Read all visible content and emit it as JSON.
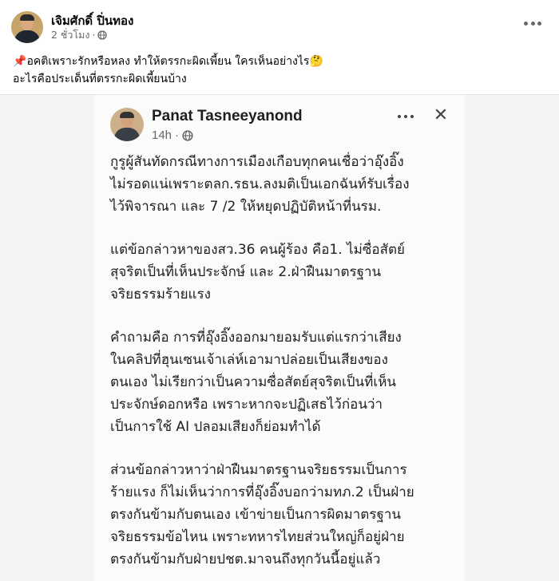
{
  "post": {
    "author": "เจิมศักดิ์ ปิ่นทอง",
    "time": "2 ชั่วโมง",
    "separator": "·",
    "privacy_icon": "globe-icon",
    "more_icon": "more-dots-icon",
    "caption_pin_icon": "📌",
    "caption_line1": "อคติเพราะรักหรือหลง ทำให้ตรรกะผิดเพี้ยน  ใครเห็นอย่างไร🤔",
    "caption_line2": "อะไรคือประเด็นที่ตรรกะผิดเพี้ยนบ้าง"
  },
  "screenshot": {
    "author": "Panat Tasneeyanond",
    "time": "14h",
    "separator": "·",
    "privacy_icon": "globe-icon",
    "close_glyph": "✕",
    "paragraphs": [
      {
        "lines": [
          "กูรูผู้สันทัดกรณีทางการเมืองเกือบทุกคนเชื่อว่าอุ๊งอิ๊ง",
          "ไม่รอดแน่เพราะตลก.รธน.ลงมติเป็นเอกฉันท์รับเรื่อง",
          "ไว้พิจารณา และ 7 /2 ให้หยุดปฏิบัติหน้าที่นรม."
        ]
      },
      {
        "lines": [
          "แต่ข้อกล่าวหาของสว.36 คนผู้ร้อง คือ1. ไม่ซื่อสัตย์",
          "สุจริตเป็นที่เห็นประจักษ์ และ 2.ฝ่าฝืนมาตรฐาน",
          "จริยธรรมร้ายแรง"
        ]
      },
      {
        "lines": [
          "คำถามคือ การที่อุ๊งอิ๊งออกมายอมรับแต่แรกว่าเสียง",
          "ในคลิปที่ฮุนเซนเจ้าเล่ห์เอามาปล่อยเป็นเสียงของ",
          "ตนเอง ไม่เรียกว่าเป็นความซื่อสัตย์สุจริตเป็นที่เห็น",
          "ประจักษ์ดอกหรือ เพราะหากจะปฏิเสธไว้ก่อนว่า",
          "เป็นการใช้ AI ปลอมเสียงก็ย่อมทำได้"
        ]
      },
      {
        "lines": [
          "ส่วนข้อกล่าวหาว่าฝ่าฝืนมาตรฐานจริยธรรมเป็นการ",
          "ร้ายแรง ก็ไม่เห็นว่าการที่อุ๊งอิ๊งบอกว่ามทภ.2 เป็นฝ่าย",
          "ตรงกันข้ามกับตนเอง เข้าข่ายเป็นการผิดมาตรฐาน",
          "จริยธรรมข้อไหน เพราะทหารไทยส่วนใหญ่ก็อยู่ฝ่าย",
          "ตรงกันข้ามกับฝ่ายปชต.มาจนถึงทุกวันนี้อยู่แล้ว"
        ]
      }
    ]
  }
}
